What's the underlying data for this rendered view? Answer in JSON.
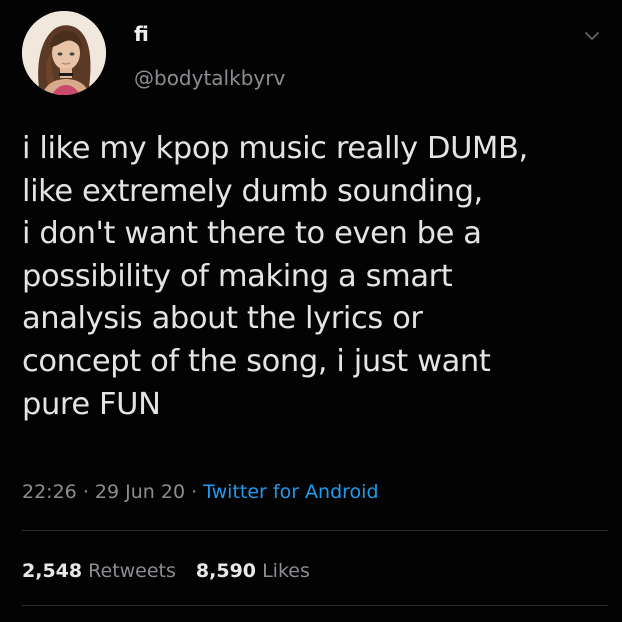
{
  "tweet": {
    "display_name": "fi",
    "handle": "@bodytalkbyrv",
    "avatar_icon": "profile-avatar",
    "menu_icon": "chevron-down-icon",
    "body_lines": [
      "i like my kpop music really DUMB,",
      "like extremely dumb sounding,",
      "i don't want there to even be a",
      "possibility of making a smart",
      "analysis about the lyrics or",
      "concept of the song, i just want",
      "pure FUN"
    ],
    "time": "22:26",
    "separator": "·",
    "date": "29 Jun 20",
    "source": "Twitter for Android",
    "retweets_count": "2,548",
    "retweets_label": "Retweets",
    "likes_count": "8,590",
    "likes_label": "Likes"
  },
  "colors": {
    "background": "#030303",
    "text": "#e4e4e4",
    "secondary": "#8a8d91",
    "link": "#1d9bf0",
    "divider": "#2b2e31"
  }
}
